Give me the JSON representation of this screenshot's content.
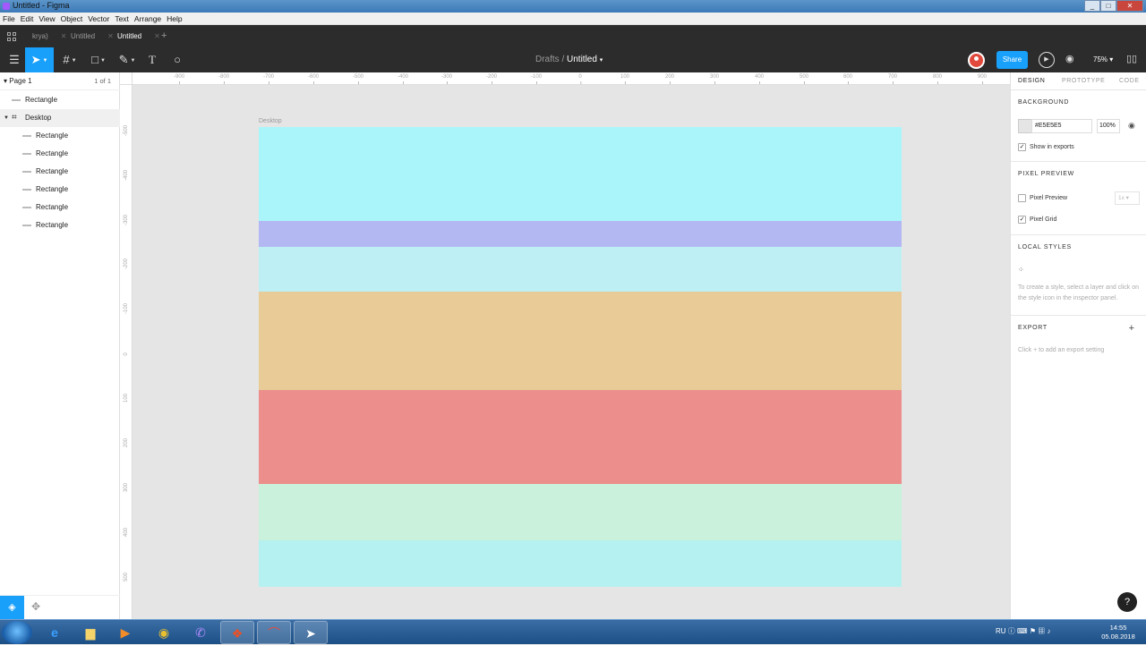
{
  "window": {
    "title": "Untitled - Figma"
  },
  "menu": [
    "File",
    "Edit",
    "View",
    "Object",
    "Vector",
    "Text",
    "Arrange",
    "Help"
  ],
  "tabs": [
    {
      "label": "krya)",
      "active": false
    },
    {
      "label": "Untitled",
      "active": false
    },
    {
      "label": "Untitled",
      "active": true
    }
  ],
  "toolbar": {
    "breadcrumb_parent": "Drafts",
    "breadcrumb_sep": "/",
    "breadcrumb_file": "Untitled",
    "share_label": "Share",
    "zoom": "75%"
  },
  "layers": {
    "page_name": "Page 1",
    "page_count": "1 of 1",
    "items": [
      {
        "label": "Rectangle",
        "type": "rect",
        "level": 0
      },
      {
        "label": "Desktop",
        "type": "frame",
        "level": 0
      },
      {
        "label": "Rectangle",
        "type": "rect",
        "level": 1
      },
      {
        "label": "Rectangle",
        "type": "rect",
        "level": 1
      },
      {
        "label": "Rectangle",
        "type": "rect",
        "level": 1
      },
      {
        "label": "Rectangle",
        "type": "rect",
        "level": 1
      },
      {
        "label": "Rectangle",
        "type": "rect",
        "level": 1
      },
      {
        "label": "Rectangle",
        "type": "rect",
        "level": 1
      }
    ]
  },
  "rulers": {
    "horizontal": [
      "-900",
      "-800",
      "-700",
      "-600",
      "-500",
      "-400",
      "-300",
      "-200",
      "-100",
      "0",
      "100",
      "200",
      "300",
      "400",
      "500",
      "600",
      "700",
      "800",
      "900"
    ],
    "vertical": [
      "-500",
      "-400",
      "-300",
      "-200",
      "-100",
      "0",
      "100",
      "200",
      "300",
      "400",
      "500"
    ]
  },
  "canvas": {
    "frame_label": "Desktop",
    "bands": [
      {
        "color": "#aaf5fa"
      },
      {
        "color": "#b3b8f2"
      },
      {
        "color": "#bdeff5"
      },
      {
        "color": "#e8cb97"
      },
      {
        "color": "#eb8e8c"
      },
      {
        "color": "#c9f1dc"
      },
      {
        "color": "#b5f1f0"
      }
    ]
  },
  "properties": {
    "tabs": [
      "DESIGN",
      "PROTOTYPE",
      "CODE"
    ],
    "background_title": "BACKGROUND",
    "background_hex": "#E5E5E5",
    "background_opacity": "100%",
    "show_in_exports": "Show in exports",
    "pixel_preview_title": "PIXEL PREVIEW",
    "pixel_preview_label": "Pixel Preview",
    "pixel_preview_scale": "1x",
    "pixel_grid_label": "Pixel Grid",
    "local_styles_title": "LOCAL STYLES",
    "local_styles_note": "To create a style, select a layer and click on the style icon in the inspector panel.",
    "export_title": "EXPORT",
    "export_note": "Click + to add an export setting"
  },
  "help_label": "?",
  "taskbar": {
    "lang": "RU",
    "time": "14:55",
    "date": "05.08.2018"
  }
}
